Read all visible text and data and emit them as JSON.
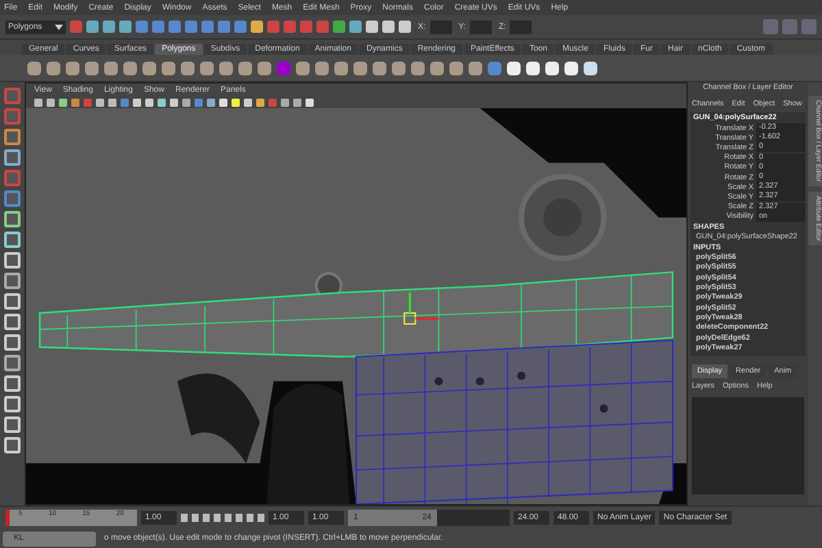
{
  "menu_bar": [
    "File",
    "Edit",
    "Modify",
    "Create",
    "Display",
    "Window",
    "Assets",
    "Select",
    "Mesh",
    "Edit Mesh",
    "Proxy",
    "Normals",
    "Color",
    "Create UVs",
    "Edit UVs",
    "Help"
  ],
  "status_line": {
    "mode": "Polygons",
    "coord_labels": [
      "X:",
      "Y:",
      "Z:"
    ]
  },
  "shelf_tabs": [
    {
      "label": "General",
      "selected": false
    },
    {
      "label": "Curves",
      "selected": false
    },
    {
      "label": "Surfaces",
      "selected": false
    },
    {
      "label": "Polygons",
      "selected": true
    },
    {
      "label": "Subdivs",
      "selected": false
    },
    {
      "label": "Deformation",
      "selected": false
    },
    {
      "label": "Animation",
      "selected": false
    },
    {
      "label": "Dynamics",
      "selected": false
    },
    {
      "label": "Rendering",
      "selected": false
    },
    {
      "label": "PaintEffects",
      "selected": false
    },
    {
      "label": "Toon",
      "selected": false
    },
    {
      "label": "Muscle",
      "selected": false
    },
    {
      "label": "Fluids",
      "selected": false
    },
    {
      "label": "Fur",
      "selected": false
    },
    {
      "label": "Hair",
      "selected": false
    },
    {
      "label": "nCloth",
      "selected": false
    },
    {
      "label": "Custom",
      "selected": false
    }
  ],
  "viewport": {
    "menus": [
      "View",
      "Shading",
      "Lighting",
      "Show",
      "Renderer",
      "Panels"
    ]
  },
  "channel_box": {
    "title": "Channel Box / Layer Editor",
    "menus": [
      "Channels",
      "Edit",
      "Object",
      "Show"
    ],
    "object": "GUN_04:polySurface22",
    "attributes": [
      {
        "name": "Translate X",
        "value": "-0.23"
      },
      {
        "name": "Translate Y",
        "value": "-1.602"
      },
      {
        "name": "Translate Z",
        "value": "0"
      },
      {
        "name": "Rotate X",
        "value": "0"
      },
      {
        "name": "Rotate Y",
        "value": "0"
      },
      {
        "name": "Rotate Z",
        "value": "0"
      },
      {
        "name": "Scale X",
        "value": "2.327"
      },
      {
        "name": "Scale Y",
        "value": "2.327"
      },
      {
        "name": "Scale Z",
        "value": "2.327"
      },
      {
        "name": "Visibility",
        "value": "on"
      }
    ],
    "shapes_heading": "SHAPES",
    "shape": "GUN_04:polySurfaceShape22",
    "inputs_heading": "INPUTS",
    "inputs": [
      "polySplit56",
      "polySplit55",
      "polySplit54",
      "polySplit53",
      "polyTweak29",
      "polySplit52",
      "polyTweak28",
      "deleteComponent22",
      "polyDelEdge62",
      "polyTweak27"
    ]
  },
  "side_tabs": [
    "Channel Box / Layer Editor",
    "Attribute Editor"
  ],
  "layer_editor": {
    "tabs": [
      {
        "label": "Display",
        "selected": true
      },
      {
        "label": "Render",
        "selected": false
      },
      {
        "label": "Anim",
        "selected": false
      }
    ],
    "menus": [
      "Layers",
      "Options",
      "Help"
    ]
  },
  "time_slider": {
    "ticks": [
      "5",
      "10",
      "15",
      "20"
    ],
    "current": "1.00",
    "level": 0
  },
  "range_slider": {
    "level": 0.55,
    "start": "1.00",
    "range_start": "1.00",
    "handle_start": "1",
    "handle_end": "24",
    "range_end": "24.00",
    "end": "48.00",
    "anim_layer": "No Anim Layer",
    "character_set": "No Character Set"
  },
  "help_line": "o move object(s). Use edit mode to change pivot (INSERT). Ctrl+LMB to move perpendicular.",
  "mini_window": {
    "label": "KL"
  }
}
